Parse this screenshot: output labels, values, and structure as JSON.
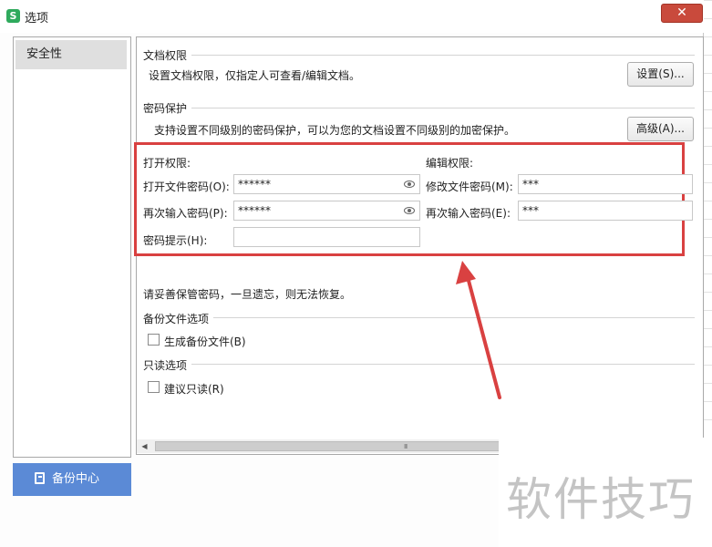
{
  "window": {
    "app_icon_text": "S",
    "title": "选项",
    "close_glyph": "✕"
  },
  "sidebar": {
    "items": [
      {
        "label": "安全性",
        "selected": true
      }
    ],
    "backup_button": {
      "label": "备份中心",
      "icon": "backup-icon"
    }
  },
  "doc_permissions": {
    "title": "文档权限",
    "desc": "设置文档权限，仅指定人可查看/编辑文档。",
    "button": "设置(S)..."
  },
  "password_protection": {
    "title": "密码保护",
    "desc": "支持设置不同级别的密码保护，可以为您的文档设置不同级别的加密保护。",
    "button": "高级(A)..."
  },
  "open_permission": {
    "title": "打开权限:",
    "password_label": "打开文件密码(O):",
    "password_value": "******",
    "confirm_label": "再次输入密码(P):",
    "confirm_value": "******",
    "hint_label": "密码提示(H):",
    "hint_value": ""
  },
  "edit_permission": {
    "title": "编辑权限:",
    "password_label": "修改文件密码(M):",
    "password_value": "***",
    "confirm_label": "再次输入密码(E):",
    "confirm_value": "***"
  },
  "warning": "请妥善保管密码，一旦遗忘，则无法恢复。",
  "backup_options": {
    "title": "备份文件选项",
    "checkbox_label": "生成备份文件(B)",
    "checked": false
  },
  "readonly_options": {
    "title": "只读选项",
    "checkbox_label": "建议只读(R)",
    "checked": false
  },
  "scrollbar": {
    "left_arrow": "◀",
    "right_arrow": "▶",
    "grip": "III"
  },
  "watermark": "软件技巧",
  "colors": {
    "highlight_border": "#d94141",
    "annotation_arrow": "#d94141",
    "backup_button_bg": "#5b8ad6",
    "close_button_bg": "#c94a3c",
    "app_icon_bg": "#2faa5d"
  }
}
